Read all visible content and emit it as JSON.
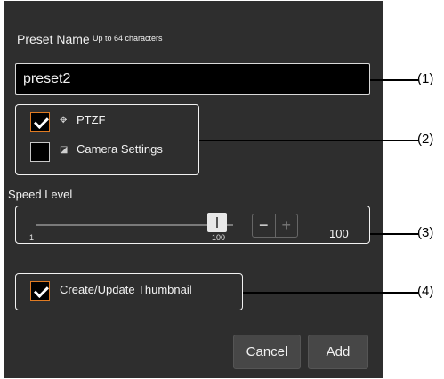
{
  "dialog": {
    "preset_name_label": "Preset Name",
    "preset_name_hint": "Up to 64 characters",
    "preset_name_value": "preset2",
    "options": [
      {
        "label": "PTZF",
        "checked": true,
        "icon": "ptzf-icon"
      },
      {
        "label": "Camera Settings",
        "checked": false,
        "icon": "camera-settings-icon"
      }
    ],
    "speed": {
      "label": "Speed Level",
      "min_label": "1",
      "max_label": "100",
      "value": "100",
      "minus": "−",
      "plus": "+"
    },
    "thumbnail": {
      "label": "Create/Update Thumbnail",
      "checked": true
    },
    "cancel_label": "Cancel",
    "add_label": "Add"
  },
  "callouts": [
    "(1)",
    "(2)",
    "(3)",
    "(4)"
  ],
  "colors": {
    "panel": "#2e2e2e",
    "checkbox_accent": "#e07b23",
    "button": "#474747"
  }
}
